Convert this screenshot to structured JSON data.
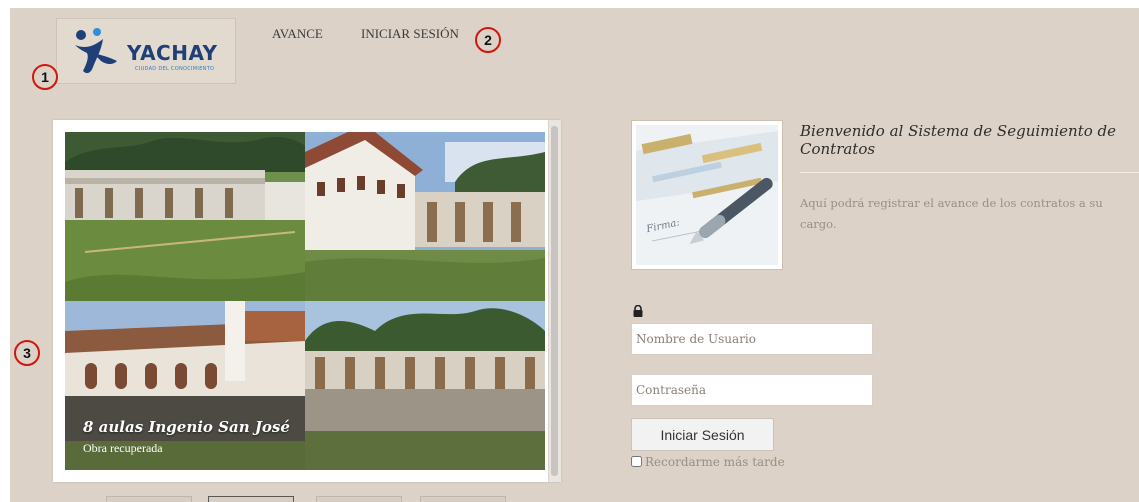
{
  "header": {
    "logo_text": "YACHAY",
    "logo_tagline": "CIUDAD DEL CONOCIMIENTO",
    "nav": [
      {
        "label": "AVANCE"
      },
      {
        "label": "INICIAR SESIÓN"
      }
    ]
  },
  "markers": [
    "1",
    "2",
    "3"
  ],
  "slideshow": {
    "caption_title": "8 aulas Ingenio San José",
    "caption_subtitle": "Obra recuperada"
  },
  "welcome": {
    "title": "Bienvenido al Sistema de Seguimiento de Contratos",
    "text": "Aquí podrá registrar el avance de los contratos a su cargo.",
    "image_label": "Firma:"
  },
  "login": {
    "username_placeholder": "Nombre de Usuario",
    "password_placeholder": "Contraseña",
    "submit_label": "Iniciar Sesión",
    "remember_label": "Recordarme más tarde"
  },
  "colors": {
    "page_background": "#ddd2c7",
    "marker_ring": "#d1160e",
    "logo_blue": "#1f3f77"
  }
}
